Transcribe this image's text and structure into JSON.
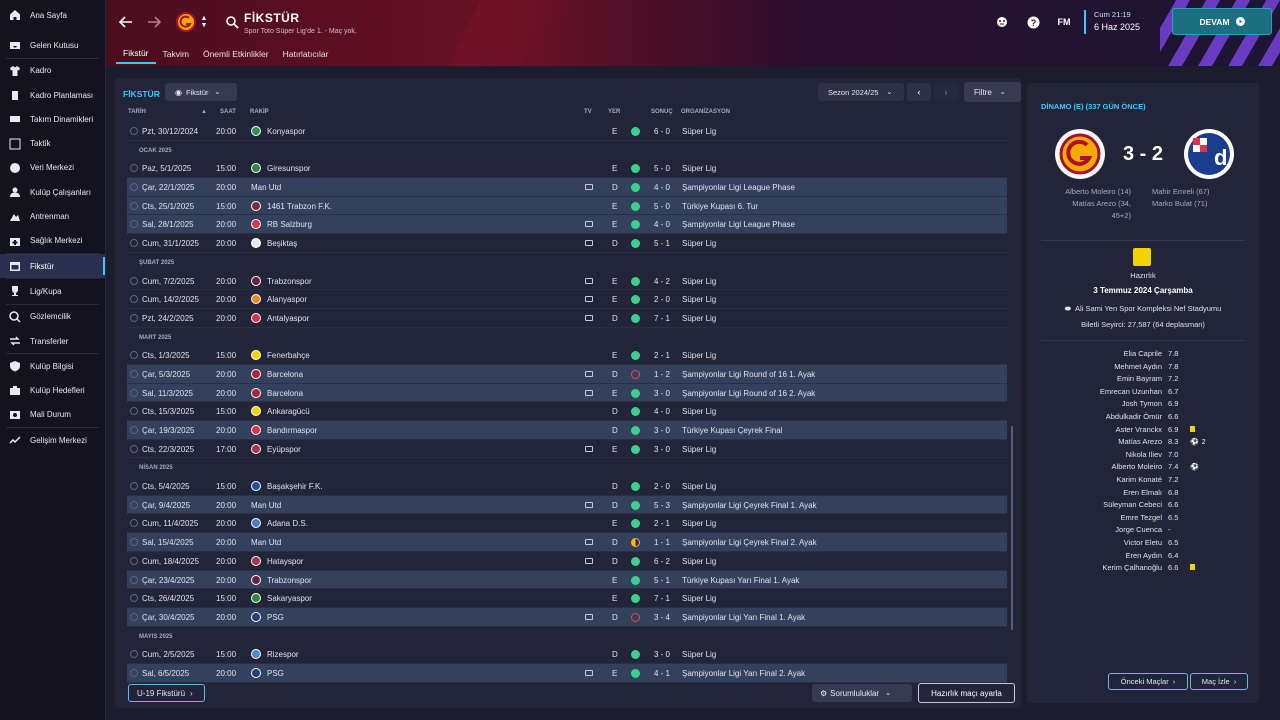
{
  "sidebar": {
    "items": [
      {
        "label": "Ana Sayfa",
        "icon": "home-icon"
      },
      {
        "label": "Gelen Kutusu",
        "icon": "inbox-icon"
      },
      {
        "label": "Kadro",
        "icon": "shirt-icon"
      },
      {
        "label": "Kadro Planlaması",
        "icon": "clipboard-icon"
      },
      {
        "label": "Takım Dinamikleri",
        "icon": "dynamics-icon"
      },
      {
        "label": "Taktik",
        "icon": "tactics-icon"
      },
      {
        "label": "Veri Merkezi",
        "icon": "data-icon"
      },
      {
        "label": "Kulüp Çalışanları",
        "icon": "staff-icon"
      },
      {
        "label": "Antrenman",
        "icon": "training-icon"
      },
      {
        "label": "Sağlık Merkezi",
        "icon": "medical-icon"
      },
      {
        "label": "Fikstür",
        "icon": "calendar-icon",
        "active": true
      },
      {
        "label": "Lig/Kupa",
        "icon": "trophy-icon"
      },
      {
        "label": "Gözlemcilik",
        "icon": "scouting-icon"
      },
      {
        "label": "Transferler",
        "icon": "transfer-icon"
      },
      {
        "label": "Kulüp Bilgisi",
        "icon": "shield-icon"
      },
      {
        "label": "Kulüp Hedefleri",
        "icon": "target-icon"
      },
      {
        "label": "Mali Durum",
        "icon": "finance-icon"
      },
      {
        "label": "Gelişim Merkezi",
        "icon": "development-icon"
      }
    ]
  },
  "header": {
    "title": "FİKSTÜR",
    "subtitle": "Spor Toto Süper Lig'de 1. - Maç yok.",
    "time": "Cum 21:19",
    "date": "6 Haz 2025",
    "continue_label": "DEVAM",
    "fm_label": "FM",
    "tabs": [
      "Fikstür",
      "Takvim",
      "Önemli Etkinlikler",
      "Hatırlatıcılar"
    ]
  },
  "main": {
    "title": "FİKSTÜR",
    "view_dropdown": "Fikstür",
    "season": "Sezon 2024/25",
    "filter_label": "Filtre",
    "columns": {
      "date": "TARİH",
      "time": "SAAT",
      "opponent": "RAKİP",
      "tv": "TV",
      "venue": "YER",
      "result": "SONUÇ",
      "competition": "ORGANİZASYON"
    },
    "u19_label": "U-19 Fikstürü",
    "responsibilities_label": "Sorumluluklar",
    "friendly_label": "Hazırlık maçı ayarla"
  },
  "fixtures": [
    {
      "type": "match",
      "date": "Pzt, 30/12/2024",
      "time": "20:00",
      "opp": "Konyaspor",
      "tv": false,
      "venue": "E",
      "res": "W",
      "score": "6 - 0",
      "comp": "Süper Lig",
      "hl": false,
      "color": "#2f8f4f"
    },
    {
      "type": "month",
      "label": "OCAK 2025"
    },
    {
      "type": "match",
      "date": "Paz, 5/1/2025",
      "time": "15:00",
      "opp": "Giresunspor",
      "tv": false,
      "venue": "E",
      "res": "W",
      "score": "5 - 0",
      "comp": "Süper Lig",
      "hl": false,
      "color": "#2e8b3e"
    },
    {
      "type": "match",
      "date": "Çar, 22/1/2025",
      "time": "20:00",
      "opp": "Man Utd",
      "tv": true,
      "venue": "D",
      "res": "W",
      "score": "4 - 0",
      "comp": "Şampiyonlar Ligi League Phase",
      "hl": true,
      "color": ""
    },
    {
      "type": "match",
      "date": "Cts, 25/1/2025",
      "time": "15:00",
      "opp": "1461 Trabzon F.K.",
      "tv": false,
      "venue": "E",
      "res": "W",
      "score": "5 - 0",
      "comp": "Türkiye Kupası 6. Tur",
      "hl": true,
      "color": "#7a2c3f"
    },
    {
      "type": "match",
      "date": "Sal, 28/1/2025",
      "time": "20:00",
      "opp": "RB Salzburg",
      "tv": true,
      "venue": "E",
      "res": "W",
      "score": "4 - 0",
      "comp": "Şampiyonlar Ligi League Phase",
      "hl": true,
      "color": "#d8344a"
    },
    {
      "type": "match",
      "date": "Cum, 31/1/2025",
      "time": "20:00",
      "opp": "Beşiktaş",
      "tv": true,
      "venue": "D",
      "res": "W",
      "score": "5 - 1",
      "comp": "Süper Lig",
      "hl": false,
      "color": "#e8e8e8"
    },
    {
      "type": "month",
      "label": "ŞUBAT 2025"
    },
    {
      "type": "match",
      "date": "Cum, 7/2/2025",
      "time": "20:00",
      "opp": "Trabzonspor",
      "tv": true,
      "venue": "E",
      "res": "W",
      "score": "4 - 2",
      "comp": "Süper Lig",
      "hl": false,
      "color": "#6b2040"
    },
    {
      "type": "match",
      "date": "Cum, 14/2/2025",
      "time": "20:00",
      "opp": "Alanyaspor",
      "tv": true,
      "venue": "E",
      "res": "W",
      "score": "2 - 0",
      "comp": "Süper Lig",
      "hl": false,
      "color": "#e88a1f"
    },
    {
      "type": "match",
      "date": "Pzt, 24/2/2025",
      "time": "20:00",
      "opp": "Antalyaspor",
      "tv": true,
      "venue": "D",
      "res": "W",
      "score": "7 - 1",
      "comp": "Süper Lig",
      "hl": false,
      "color": "#d8344a"
    },
    {
      "type": "month",
      "label": "MART 2025"
    },
    {
      "type": "match",
      "date": "Cts, 1/3/2025",
      "time": "15:00",
      "opp": "Fenerbahçe",
      "tv": false,
      "venue": "E",
      "res": "W",
      "score": "2 - 1",
      "comp": "Süper Lig",
      "hl": false,
      "color": "#f2d500"
    },
    {
      "type": "match",
      "date": "Çar, 5/3/2025",
      "time": "20:00",
      "opp": "Barcelona",
      "tv": true,
      "venue": "D",
      "res": "L",
      "score": "1 - 2",
      "comp": "Şampiyonlar Ligi Round of 16 1. Ayak",
      "hl": true,
      "color": "#a8243a"
    },
    {
      "type": "match",
      "date": "Sal, 11/3/2025",
      "time": "20:00",
      "opp": "Barcelona",
      "tv": true,
      "venue": "E",
      "res": "W",
      "score": "3 - 0",
      "comp": "Şampiyonlar Ligi Round of 16 2. Ayak",
      "hl": true,
      "color": "#a8243a"
    },
    {
      "type": "match",
      "date": "Cts, 15/3/2025",
      "time": "15:00",
      "opp": "Ankaragücü",
      "tv": false,
      "venue": "D",
      "res": "W",
      "score": "4 - 0",
      "comp": "Süper Lig",
      "hl": false,
      "color": "#f2d500"
    },
    {
      "type": "match",
      "date": "Çar, 19/3/2025",
      "time": "20:00",
      "opp": "Bandırmaspor",
      "tv": false,
      "venue": "D",
      "res": "W",
      "score": "3 - 0",
      "comp": "Türkiye Kupası Çeyrek Final",
      "hl": true,
      "color": "#d8344a"
    },
    {
      "type": "match",
      "date": "Cts, 22/3/2025",
      "time": "17:00",
      "opp": "Eyüpspor",
      "tv": true,
      "venue": "E",
      "res": "W",
      "score": "3 - 0",
      "comp": "Süper Lig",
      "hl": false,
      "color": "#b0304a"
    },
    {
      "type": "month",
      "label": "NİSAN 2025"
    },
    {
      "type": "match",
      "date": "Cts, 5/4/2025",
      "time": "15:00",
      "opp": "Başakşehir F.K.",
      "tv": false,
      "venue": "D",
      "res": "W",
      "score": "2 - 0",
      "comp": "Süper Lig",
      "hl": false,
      "color": "#1e4ea8"
    },
    {
      "type": "match",
      "date": "Çar, 9/4/2025",
      "time": "20:00",
      "opp": "Man Utd",
      "tv": true,
      "venue": "D",
      "res": "W",
      "score": "5 - 3",
      "comp": "Şampiyonlar Ligi Çeyrek Final 1. Ayak",
      "hl": true,
      "color": ""
    },
    {
      "type": "match",
      "date": "Cum, 11/4/2025",
      "time": "20:00",
      "opp": "Adana D.S.",
      "tv": false,
      "venue": "E",
      "res": "W",
      "score": "2 - 1",
      "comp": "Süper Lig",
      "hl": false,
      "color": "#4a78d0"
    },
    {
      "type": "match",
      "date": "Sal, 15/4/2025",
      "time": "20:00",
      "opp": "Man Utd",
      "tv": true,
      "venue": "D",
      "res": "D",
      "score": "1 - 1",
      "comp": "Şampiyonlar Ligi Çeyrek Final 2. Ayak",
      "hl": true,
      "color": ""
    },
    {
      "type": "match",
      "date": "Cum, 18/4/2025",
      "time": "20:00",
      "opp": "Hatayspor",
      "tv": true,
      "venue": "D",
      "res": "W",
      "score": "6 - 2",
      "comp": "Süper Lig",
      "hl": false,
      "color": "#b0304a"
    },
    {
      "type": "match",
      "date": "Çar, 23/4/2025",
      "time": "20:00",
      "opp": "Trabzonspor",
      "tv": false,
      "venue": "E",
      "res": "W",
      "score": "5 - 1",
      "comp": "Türkiye Kupası Yarı Final 1. Ayak",
      "hl": true,
      "color": "#6b2040"
    },
    {
      "type": "match",
      "date": "Cts, 26/4/2025",
      "time": "15:00",
      "opp": "Sakaryaspor",
      "tv": false,
      "venue": "E",
      "res": "W",
      "score": "7 - 1",
      "comp": "Süper Lig",
      "hl": false,
      "color": "#2e8b3e"
    },
    {
      "type": "match",
      "date": "Çar, 30/4/2025",
      "time": "20:00",
      "opp": "PSG",
      "tv": true,
      "venue": "D",
      "res": "L",
      "score": "3 - 4",
      "comp": "Şampiyonlar Ligi Yarı Final 1. Ayak",
      "hl": true,
      "color": "#1e3e7a"
    },
    {
      "type": "month",
      "label": "MAYIS 2025"
    },
    {
      "type": "match",
      "date": "Cum, 2/5/2025",
      "time": "15:00",
      "opp": "Rizespor",
      "tv": false,
      "venue": "D",
      "res": "W",
      "score": "3 - 0",
      "comp": "Süper Lig",
      "hl": false,
      "color": "#4a8ad0"
    },
    {
      "type": "match",
      "date": "Sal, 6/5/2025",
      "time": "20:00",
      "opp": "PSG",
      "tv": true,
      "venue": "E",
      "res": "W",
      "score": "4 - 1",
      "comp": "Şampiyonlar Ligi Yarı Final 2. Ayak",
      "hl": true,
      "color": "#1e3e7a"
    }
  ],
  "detail": {
    "title": "DİNAMO (E) (337 GÜN ÖNCE)",
    "score": "3 - 2",
    "home_scorers": [
      "Alberto Moleiro (14)",
      "Matías Arezo (34,",
      "45+2)"
    ],
    "away_scorers": [
      "Mahir Emreli (67)",
      "Marko Bulat (71)"
    ],
    "competition": "Hazırlık",
    "date": "3 Temmuz 2024 Çarşamba",
    "stadium": "Ali Sami Yen Spor Kompleksi Nef Stadyumu",
    "attendance": "Biletli Seyirci: 27,587 (64 deplasman)",
    "players": [
      {
        "name": "Elia Caprile",
        "rating": "7.8",
        "extra": ""
      },
      {
        "name": "Mehmet Aydın",
        "rating": "7.8",
        "extra": ""
      },
      {
        "name": "Emin Bayram",
        "rating": "7.2",
        "extra": ""
      },
      {
        "name": "Emrecan Uzunhan",
        "rating": "6.7",
        "extra": ""
      },
      {
        "name": "Josh Tymon",
        "rating": "6.9",
        "extra": ""
      },
      {
        "name": "Abdulkadir Ömür",
        "rating": "6.6",
        "extra": ""
      },
      {
        "name": "Aster Vranckx",
        "rating": "6.9",
        "extra": "yellow"
      },
      {
        "name": "Matías Arezo",
        "rating": "8.3",
        "extra": "goal",
        "goals": "2"
      },
      {
        "name": "Nikola Iliev",
        "rating": "7.0",
        "extra": ""
      },
      {
        "name": "Alberto Moleiro",
        "rating": "7.4",
        "extra": "goal",
        "goals": ""
      },
      {
        "name": "Karim Konaté",
        "rating": "7.2",
        "extra": ""
      },
      {
        "name": "Eren Elmalı",
        "rating": "6.8",
        "extra": ""
      },
      {
        "name": "Süleyman Cebeci",
        "rating": "6.6",
        "extra": ""
      },
      {
        "name": "Emre Tezgel",
        "rating": "6.5",
        "extra": ""
      },
      {
        "name": "Jorge Cuenca",
        "rating": "-",
        "extra": ""
      },
      {
        "name": "Victor Eletu",
        "rating": "6.5",
        "extra": ""
      },
      {
        "name": "Eren Aydın",
        "rating": "6.4",
        "extra": ""
      },
      {
        "name": "Kerim Çalhanoğlu",
        "rating": "6.6",
        "extra": "yellow"
      }
    ],
    "prev_label": "Önceki Maçlar",
    "watch_label": "Maç İzle"
  }
}
